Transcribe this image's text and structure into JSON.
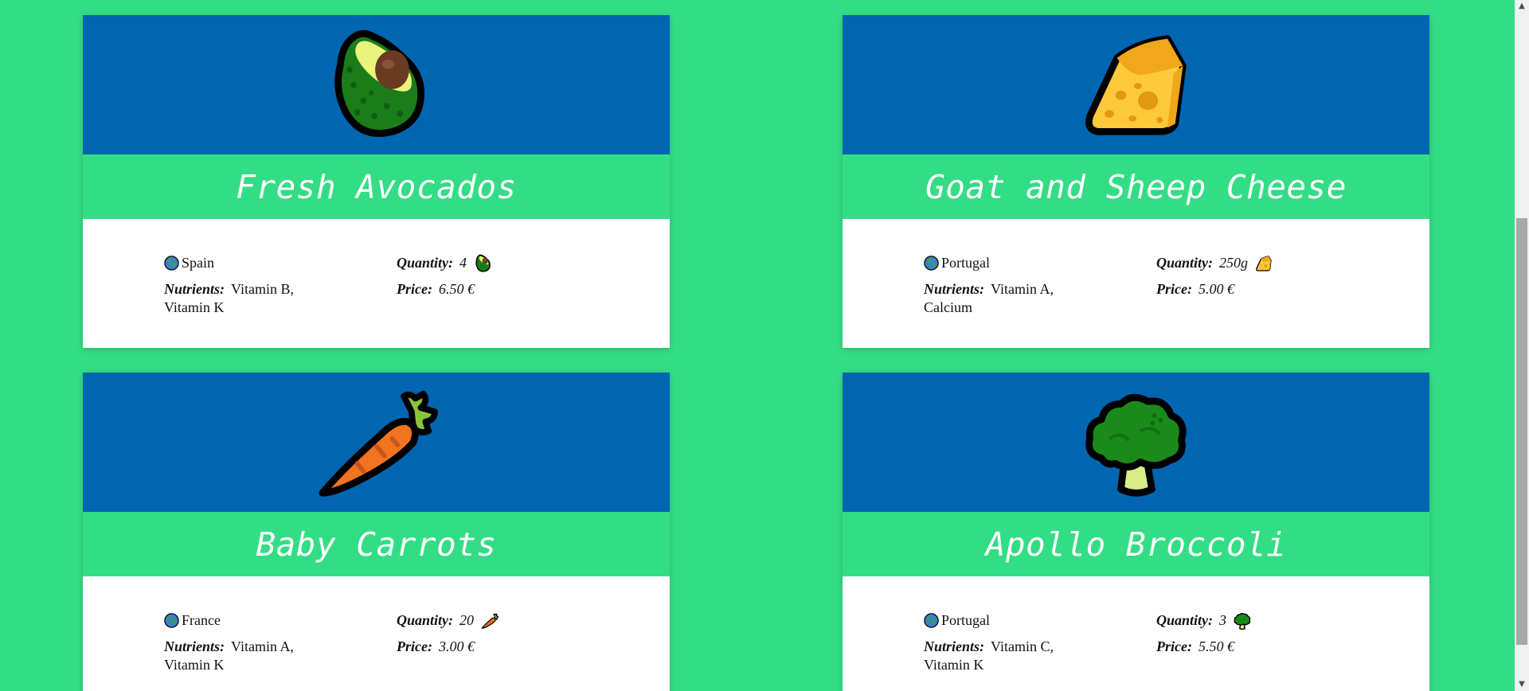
{
  "products": [
    {
      "title": "Fresh Avocados",
      "icon": "avocado-icon",
      "origin": "Spain",
      "nutrients_label": "Nutrients:",
      "nutrients": "Vitamin B, Vitamin K",
      "quantity_label": "Quantity:",
      "quantity": "4",
      "price_label": "Price:",
      "price": "6.50 €"
    },
    {
      "title": "Goat and Sheep Cheese",
      "icon": "cheese-icon",
      "origin": "Portugal",
      "nutrients_label": "Nutrients:",
      "nutrients": "Vitamin A, Calcium",
      "quantity_label": "Quantity:",
      "quantity": "250g",
      "price_label": "Price:",
      "price": "5.00 €"
    },
    {
      "title": "Baby Carrots",
      "icon": "carrot-icon",
      "origin": "France",
      "nutrients_label": "Nutrients:",
      "nutrients": "Vitamin A, Vitamin K",
      "quantity_label": "Quantity:",
      "quantity": "20",
      "price_label": "Price:",
      "price": "3.00 €"
    },
    {
      "title": "Apollo Broccoli",
      "icon": "broccoli-icon",
      "origin": "Portugal",
      "nutrients_label": "Nutrients:",
      "nutrients": "Vitamin C, Vitamin K",
      "quantity_label": "Quantity:",
      "quantity": "3",
      "price_label": "Price:",
      "price": "5.50 €"
    }
  ],
  "colors": {
    "background": "#33DD85",
    "banner": "#0066B1",
    "card": "#FFFFFF",
    "title_text": "#FFFFFF"
  }
}
